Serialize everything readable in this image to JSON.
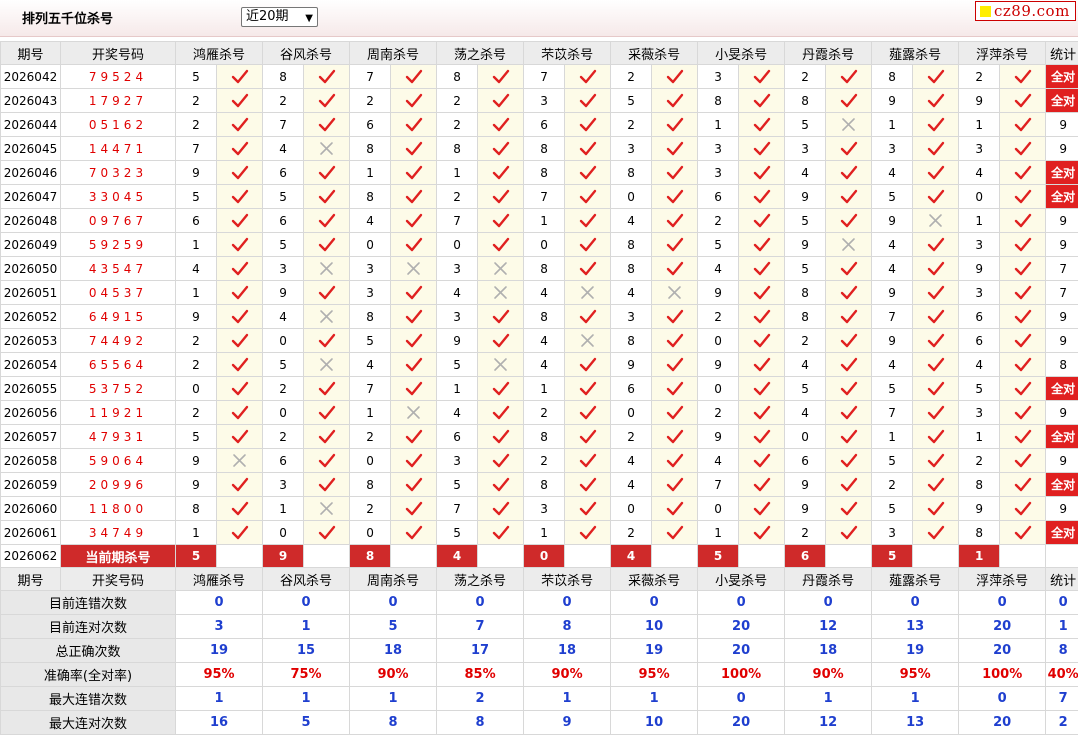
{
  "header": {
    "title": "排列五千位杀号",
    "period_select": "近20期",
    "logo_text": "cz89.com"
  },
  "columns": {
    "issue": "期号",
    "draw": "开奖号码",
    "experts": [
      "鸿雁杀号",
      "谷风杀号",
      "周南杀号",
      "荡之杀号",
      "芣苡杀号",
      "采薇杀号",
      "小旻杀号",
      "丹霞杀号",
      "薤露杀号",
      "浮萍杀号"
    ],
    "stat": "统计"
  },
  "rows": [
    {
      "issue": "2026042",
      "draw": "79524",
      "kills": [
        5,
        8,
        7,
        8,
        7,
        2,
        3,
        2,
        8,
        2
      ],
      "hits": [
        1,
        1,
        1,
        1,
        1,
        1,
        1,
        1,
        1,
        1
      ],
      "stat": "全对"
    },
    {
      "issue": "2026043",
      "draw": "17927",
      "kills": [
        2,
        2,
        2,
        2,
        3,
        5,
        8,
        8,
        9,
        9
      ],
      "hits": [
        1,
        1,
        1,
        1,
        1,
        1,
        1,
        1,
        1,
        1
      ],
      "stat": "全对"
    },
    {
      "issue": "2026044",
      "draw": "05162",
      "kills": [
        2,
        7,
        6,
        2,
        6,
        2,
        1,
        5,
        1,
        1
      ],
      "hits": [
        1,
        1,
        1,
        1,
        1,
        1,
        1,
        0,
        1,
        1
      ],
      "stat": "9"
    },
    {
      "issue": "2026045",
      "draw": "14471",
      "kills": [
        7,
        4,
        8,
        8,
        8,
        3,
        3,
        3,
        3,
        3
      ],
      "hits": [
        1,
        0,
        1,
        1,
        1,
        1,
        1,
        1,
        1,
        1
      ],
      "stat": "9"
    },
    {
      "issue": "2026046",
      "draw": "70323",
      "kills": [
        9,
        6,
        1,
        1,
        8,
        8,
        3,
        4,
        4,
        4
      ],
      "hits": [
        1,
        1,
        1,
        1,
        1,
        1,
        1,
        1,
        1,
        1
      ],
      "stat": "全对"
    },
    {
      "issue": "2026047",
      "draw": "33045",
      "kills": [
        5,
        5,
        8,
        2,
        7,
        0,
        6,
        9,
        5,
        0
      ],
      "hits": [
        1,
        1,
        1,
        1,
        1,
        1,
        1,
        1,
        1,
        1
      ],
      "stat": "全对"
    },
    {
      "issue": "2026048",
      "draw": "09767",
      "kills": [
        6,
        6,
        4,
        7,
        1,
        4,
        2,
        5,
        9,
        1
      ],
      "hits": [
        1,
        1,
        1,
        1,
        1,
        1,
        1,
        1,
        0,
        1
      ],
      "stat": "9"
    },
    {
      "issue": "2026049",
      "draw": "59259",
      "kills": [
        1,
        5,
        0,
        0,
        0,
        8,
        5,
        9,
        4,
        3
      ],
      "hits": [
        1,
        1,
        1,
        1,
        1,
        1,
        1,
        0,
        1,
        1
      ],
      "stat": "9"
    },
    {
      "issue": "2026050",
      "draw": "43547",
      "kills": [
        4,
        3,
        3,
        3,
        8,
        8,
        4,
        5,
        4,
        9
      ],
      "hits": [
        1,
        0,
        0,
        0,
        1,
        1,
        1,
        1,
        1,
        1
      ],
      "stat": "7"
    },
    {
      "issue": "2026051",
      "draw": "04537",
      "kills": [
        1,
        9,
        3,
        4,
        4,
        4,
        9,
        8,
        9,
        3
      ],
      "hits": [
        1,
        1,
        1,
        0,
        0,
        0,
        1,
        1,
        1,
        1
      ],
      "stat": "7"
    },
    {
      "issue": "2026052",
      "draw": "64915",
      "kills": [
        9,
        4,
        8,
        3,
        8,
        3,
        2,
        8,
        7,
        6
      ],
      "hits": [
        1,
        0,
        1,
        1,
        1,
        1,
        1,
        1,
        1,
        1
      ],
      "stat": "9"
    },
    {
      "issue": "2026053",
      "draw": "74492",
      "kills": [
        2,
        0,
        5,
        9,
        4,
        8,
        0,
        2,
        9,
        6
      ],
      "hits": [
        1,
        1,
        1,
        1,
        0,
        1,
        1,
        1,
        1,
        1
      ],
      "stat": "9"
    },
    {
      "issue": "2026054",
      "draw": "65564",
      "kills": [
        2,
        5,
        4,
        5,
        4,
        9,
        9,
        4,
        4,
        4
      ],
      "hits": [
        1,
        0,
        1,
        0,
        1,
        1,
        1,
        1,
        1,
        1
      ],
      "stat": "8"
    },
    {
      "issue": "2026055",
      "draw": "53752",
      "kills": [
        0,
        2,
        7,
        1,
        1,
        6,
        0,
        5,
        5,
        5
      ],
      "hits": [
        1,
        1,
        1,
        1,
        1,
        1,
        1,
        1,
        1,
        1
      ],
      "stat": "全对"
    },
    {
      "issue": "2026056",
      "draw": "11921",
      "kills": [
        2,
        0,
        1,
        4,
        2,
        0,
        2,
        4,
        7,
        3
      ],
      "hits": [
        1,
        1,
        0,
        1,
        1,
        1,
        1,
        1,
        1,
        1
      ],
      "stat": "9"
    },
    {
      "issue": "2026057",
      "draw": "47931",
      "kills": [
        5,
        2,
        2,
        6,
        8,
        2,
        9,
        0,
        1,
        1
      ],
      "hits": [
        1,
        1,
        1,
        1,
        1,
        1,
        1,
        1,
        1,
        1
      ],
      "stat": "全对"
    },
    {
      "issue": "2026058",
      "draw": "59064",
      "kills": [
        9,
        6,
        0,
        3,
        2,
        4,
        4,
        6,
        5,
        2
      ],
      "hits": [
        0,
        1,
        1,
        1,
        1,
        1,
        1,
        1,
        1,
        1
      ],
      "stat": "9"
    },
    {
      "issue": "2026059",
      "draw": "20996",
      "kills": [
        9,
        3,
        8,
        5,
        8,
        4,
        7,
        9,
        2,
        8
      ],
      "hits": [
        1,
        1,
        1,
        1,
        1,
        1,
        1,
        1,
        1,
        1
      ],
      "stat": "全对"
    },
    {
      "issue": "2026060",
      "draw": "11800",
      "kills": [
        8,
        1,
        2,
        7,
        3,
        0,
        0,
        9,
        5,
        9
      ],
      "hits": [
        1,
        0,
        1,
        1,
        1,
        1,
        1,
        1,
        1,
        1
      ],
      "stat": "9"
    },
    {
      "issue": "2026061",
      "draw": "34749",
      "kills": [
        1,
        0,
        0,
        5,
        1,
        2,
        1,
        2,
        3,
        8
      ],
      "hits": [
        1,
        1,
        1,
        1,
        1,
        1,
        1,
        1,
        1,
        1
      ],
      "stat": "全对"
    }
  ],
  "current": {
    "issue": "2026062",
    "label": "当前期杀号",
    "kills": [
      5,
      9,
      8,
      4,
      0,
      4,
      5,
      6,
      5,
      1
    ]
  },
  "stats": {
    "rows": [
      {
        "label": "目前连错次数",
        "values": [
          "0",
          "0",
          "0",
          "0",
          "0",
          "0",
          "0",
          "0",
          "0",
          "0",
          "0"
        ]
      },
      {
        "label": "目前连对次数",
        "values": [
          "3",
          "1",
          "5",
          "7",
          "8",
          "10",
          "20",
          "12",
          "13",
          "20",
          "1"
        ]
      },
      {
        "label": "总正确次数",
        "values": [
          "19",
          "15",
          "18",
          "17",
          "18",
          "19",
          "20",
          "18",
          "19",
          "20",
          "8"
        ]
      },
      {
        "label": "准确率(全对率)",
        "values": [
          "95%",
          "75%",
          "90%",
          "85%",
          "90%",
          "95%",
          "100%",
          "90%",
          "95%",
          "100%",
          "40%"
        ]
      },
      {
        "label": "最大连错次数",
        "values": [
          "1",
          "1",
          "1",
          "2",
          "1",
          "1",
          "0",
          "1",
          "1",
          "0",
          "7"
        ]
      },
      {
        "label": "最大连对次数",
        "values": [
          "16",
          "5",
          "8",
          "8",
          "9",
          "10",
          "20",
          "12",
          "13",
          "20",
          "2"
        ]
      }
    ]
  },
  "icons": {
    "hit": "check-icon",
    "miss": "cross-icon"
  },
  "colors": {
    "hit": "#e02020",
    "miss": "#b0b0b0",
    "all_correct_bg": "#e02020",
    "current_bg": "#cf2a2a",
    "stat_value": "#1f3fcf"
  }
}
